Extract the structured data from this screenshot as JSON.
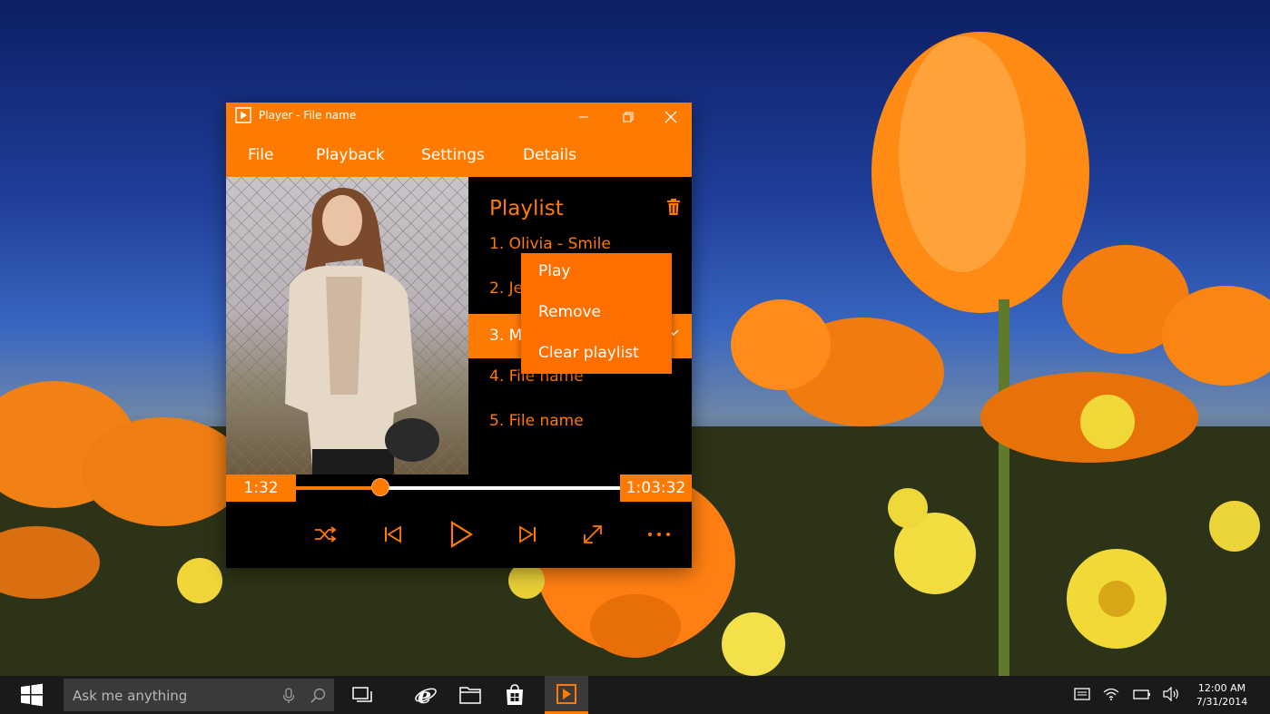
{
  "window": {
    "title": "Player - File name",
    "accent_color": "#ff7a00",
    "menu": [
      "File",
      "Playback",
      "Settings",
      "Details"
    ]
  },
  "playlist": {
    "title": "Playlist",
    "items": [
      {
        "label": "1. Olivia - Smile",
        "selected": false
      },
      {
        "label": "2. Je",
        "selected": false
      },
      {
        "label": "3. M",
        "selected": true
      },
      {
        "label": "4. File name",
        "selected": false
      },
      {
        "label": "5. File name",
        "selected": false
      }
    ]
  },
  "context_menu": {
    "items": [
      "Play",
      "Remove",
      "Clear playlist"
    ]
  },
  "seek": {
    "current_time": "1:32",
    "total_time": "1:03:32",
    "progress": 0.26
  },
  "controls": [
    "shuffle-icon",
    "previous-icon",
    "play-icon",
    "next-icon",
    "fullscreen-icon",
    "more-icon"
  ],
  "taskbar": {
    "search_placeholder": "Ask me anything",
    "time": "12:00 AM",
    "date": "7/31/2014"
  }
}
